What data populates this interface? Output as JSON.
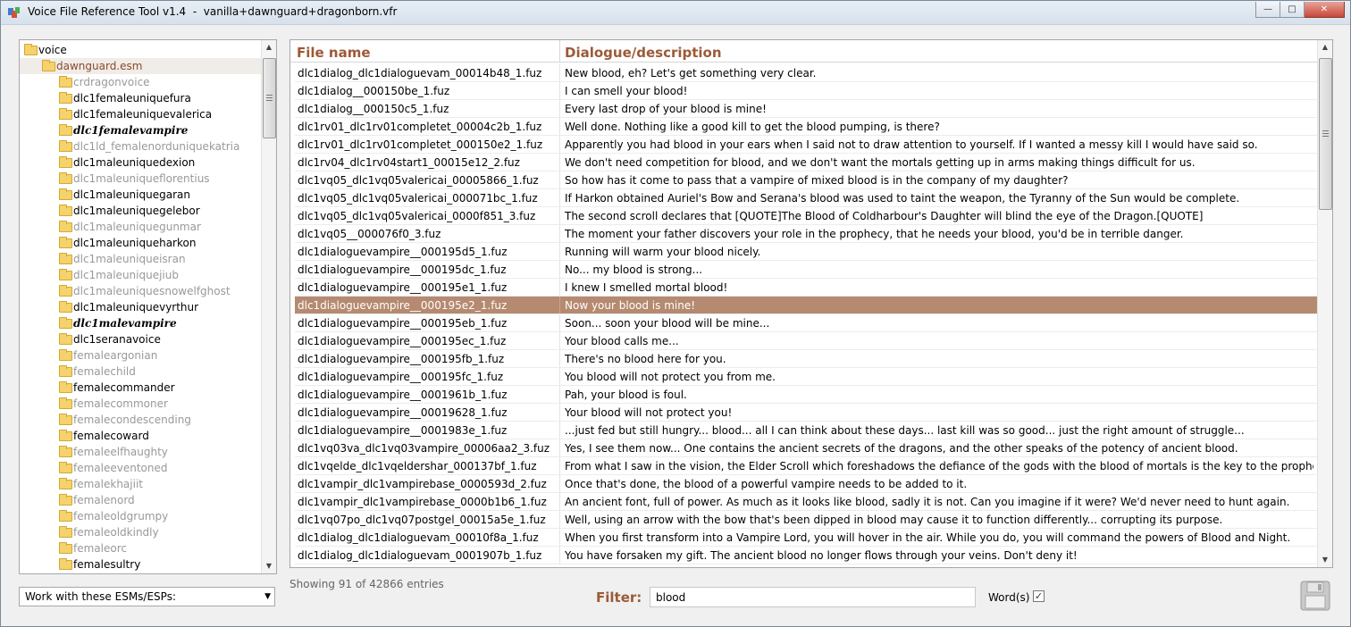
{
  "window": {
    "title": "Voice File Reference Tool v1.4  -  vanilla+dawnguard+dragonborn.vfr",
    "minimize_icon": "minimize-icon",
    "maximize_icon": "maximize-icon",
    "close_icon": "close-icon"
  },
  "tree": {
    "items": [
      {
        "label": "voice",
        "level": 0,
        "style": "normal"
      },
      {
        "label": "dawnguard.esm",
        "level": 1,
        "style": "brown"
      },
      {
        "label": "crdragonvoice",
        "level": 2,
        "style": "grey"
      },
      {
        "label": "dlc1femaleuniquefura",
        "level": 2,
        "style": "normal"
      },
      {
        "label": "dlc1femaleuniquevalerica",
        "level": 2,
        "style": "normal"
      },
      {
        "label": "dlc1femalevampire",
        "level": 2,
        "style": "bold"
      },
      {
        "label": "dlc1ld_femalenorduniquekatria",
        "level": 2,
        "style": "grey"
      },
      {
        "label": "dlc1maleuniquedexion",
        "level": 2,
        "style": "normal"
      },
      {
        "label": "dlc1maleuniqueflorentius",
        "level": 2,
        "style": "grey"
      },
      {
        "label": "dlc1maleuniquegaran",
        "level": 2,
        "style": "normal"
      },
      {
        "label": "dlc1maleuniquegelebor",
        "level": 2,
        "style": "normal"
      },
      {
        "label": "dlc1maleuniquegunmar",
        "level": 2,
        "style": "grey"
      },
      {
        "label": "dlc1maleuniqueharkon",
        "level": 2,
        "style": "normal"
      },
      {
        "label": "dlc1maleuniqueisran",
        "level": 2,
        "style": "grey"
      },
      {
        "label": "dlc1maleuniquejiub",
        "level": 2,
        "style": "grey"
      },
      {
        "label": "dlc1maleuniquesnowelfghost",
        "level": 2,
        "style": "grey"
      },
      {
        "label": "dlc1maleuniquevyrthur",
        "level": 2,
        "style": "normal"
      },
      {
        "label": "dlc1malevampire",
        "level": 2,
        "style": "bold"
      },
      {
        "label": "dlc1seranavoice",
        "level": 2,
        "style": "normal"
      },
      {
        "label": "femaleargonian",
        "level": 2,
        "style": "grey"
      },
      {
        "label": "femalechild",
        "level": 2,
        "style": "grey"
      },
      {
        "label": "femalecommander",
        "level": 2,
        "style": "normal"
      },
      {
        "label": "femalecommoner",
        "level": 2,
        "style": "grey"
      },
      {
        "label": "femalecondescending",
        "level": 2,
        "style": "grey"
      },
      {
        "label": "femalecoward",
        "level": 2,
        "style": "normal"
      },
      {
        "label": "femaleelfhaughty",
        "level": 2,
        "style": "grey"
      },
      {
        "label": "femaleeventoned",
        "level": 2,
        "style": "grey"
      },
      {
        "label": "femalekhajiit",
        "level": 2,
        "style": "grey"
      },
      {
        "label": "femalenord",
        "level": 2,
        "style": "grey"
      },
      {
        "label": "femaleoldgrumpy",
        "level": 2,
        "style": "grey"
      },
      {
        "label": "femaleoldkindly",
        "level": 2,
        "style": "grey"
      },
      {
        "label": "femaleorc",
        "level": 2,
        "style": "grey"
      },
      {
        "label": "femalesultry",
        "level": 2,
        "style": "normal"
      }
    ]
  },
  "esm_select": {
    "value": "Work with these ESMs/ESPs:"
  },
  "table": {
    "headers": [
      "File name",
      "Dialogue/description"
    ],
    "selected_index": 13,
    "rows": [
      [
        "dlc1dialog_dlc1dialoguevam_00014b48_1.fuz",
        "New blood, eh? Let's get something very clear."
      ],
      [
        "dlc1dialog__000150be_1.fuz",
        "I can smell your blood!"
      ],
      [
        "dlc1dialog__000150c5_1.fuz",
        "Every last drop of your blood is mine!"
      ],
      [
        "dlc1rv01_dlc1rv01completet_00004c2b_1.fuz",
        "Well done. Nothing like a good kill to get the blood pumping, is there?"
      ],
      [
        "dlc1rv01_dlc1rv01completet_000150e2_1.fuz",
        "Apparently you had blood in your ears when I said not to draw attention to yourself. If I wanted a messy kill I would have said so."
      ],
      [
        "dlc1rv04_dlc1rv04start1_00015e12_2.fuz",
        "We don't need competition for blood, and we don't want the mortals getting up in arms making things difficult for us."
      ],
      [
        "dlc1vq05_dlc1vq05valericai_00005866_1.fuz",
        "So how has it come to pass that a vampire of mixed blood is in the company of my daughter?"
      ],
      [
        "dlc1vq05_dlc1vq05valericai_000071bc_1.fuz",
        "If Harkon obtained Auriel's Bow and Serana's blood was used to taint the weapon, the Tyranny of the Sun would be complete."
      ],
      [
        "dlc1vq05_dlc1vq05valericai_0000f851_3.fuz",
        "The second scroll declares that [QUOTE]The Blood of Coldharbour's Daughter will blind the eye of the Dragon.[QUOTE]"
      ],
      [
        "dlc1vq05__000076f0_3.fuz",
        "The moment your father discovers your role in the prophecy, that he needs your blood, you'd be in terrible danger."
      ],
      [
        "dlc1dialoguevampire__000195d5_1.fuz",
        "Running will warm your blood nicely."
      ],
      [
        "dlc1dialoguevampire__000195dc_1.fuz",
        "No... my blood is strong..."
      ],
      [
        "dlc1dialoguevampire__000195e1_1.fuz",
        "I knew I smelled mortal blood!"
      ],
      [
        "dlc1dialoguevampire__000195e2_1.fuz",
        "Now your blood is mine!"
      ],
      [
        "dlc1dialoguevampire__000195eb_1.fuz",
        "Soon... soon your blood will be mine..."
      ],
      [
        "dlc1dialoguevampire__000195ec_1.fuz",
        "Your blood calls me..."
      ],
      [
        "dlc1dialoguevampire__000195fb_1.fuz",
        "There's no blood here for you."
      ],
      [
        "dlc1dialoguevampire__000195fc_1.fuz",
        "You blood will not protect you from me."
      ],
      [
        "dlc1dialoguevampire__0001961b_1.fuz",
        "Pah, your blood is foul."
      ],
      [
        "dlc1dialoguevampire__00019628_1.fuz",
        "Your blood will not protect you!"
      ],
      [
        "dlc1dialoguevampire__0001983e_1.fuz",
        "...just fed but still hungry... blood... all I can think about these days... last kill was so good... just the right amount of struggle..."
      ],
      [
        "dlc1vq03va_dlc1vq03vampire_00006aa2_3.fuz",
        "Yes, I see them now... One contains the ancient secrets of the dragons, and the other speaks of the potency of ancient blood."
      ],
      [
        "dlc1vqelde_dlc1vqeldershar_000137bf_1.fuz",
        "From what I saw in the vision, the Elder Scroll which foreshadows the defiance of the gods with the blood of mortals is the key to the prophecy."
      ],
      [
        "dlc1vampir_dlc1vampirebase_0000593d_2.fuz",
        "Once that's done, the blood of a powerful vampire needs to be added to it."
      ],
      [
        "dlc1vampir_dlc1vampirebase_0000b1b6_1.fuz",
        "An ancient font, full of power. As much as it looks like blood, sadly it is not. Can you imagine if it were? We'd never need to hunt again."
      ],
      [
        "dlc1vq07po_dlc1vq07postgel_00015a5e_1.fuz",
        "Well, using an arrow with the bow that's been dipped in blood may cause it to function differently... corrupting its purpose."
      ],
      [
        "dlc1dialog_dlc1dialoguevam_00010f8a_1.fuz",
        "When you first transform into a Vampire Lord, you will hover in the air. While you do, you will command the powers of Blood and Night."
      ],
      [
        "dlc1dialog_dlc1dialoguevam_0001907b_1.fuz",
        "You have forsaken my gift. The ancient blood no longer flows through your veins. Don't deny it!"
      ]
    ]
  },
  "status": {
    "text": "Showing 91 of 42866 entries"
  },
  "filter": {
    "label": "Filter:",
    "value": "blood",
    "words_label": "Word(s)",
    "words_checked": true
  },
  "icons": {
    "save": "floppy-disk-icon",
    "app": "app-icon",
    "folder": "folder-icon"
  },
  "colors": {
    "header_accent": "#9c5a36",
    "selected_row": "#b58a70",
    "folder": "#f5d26b"
  }
}
